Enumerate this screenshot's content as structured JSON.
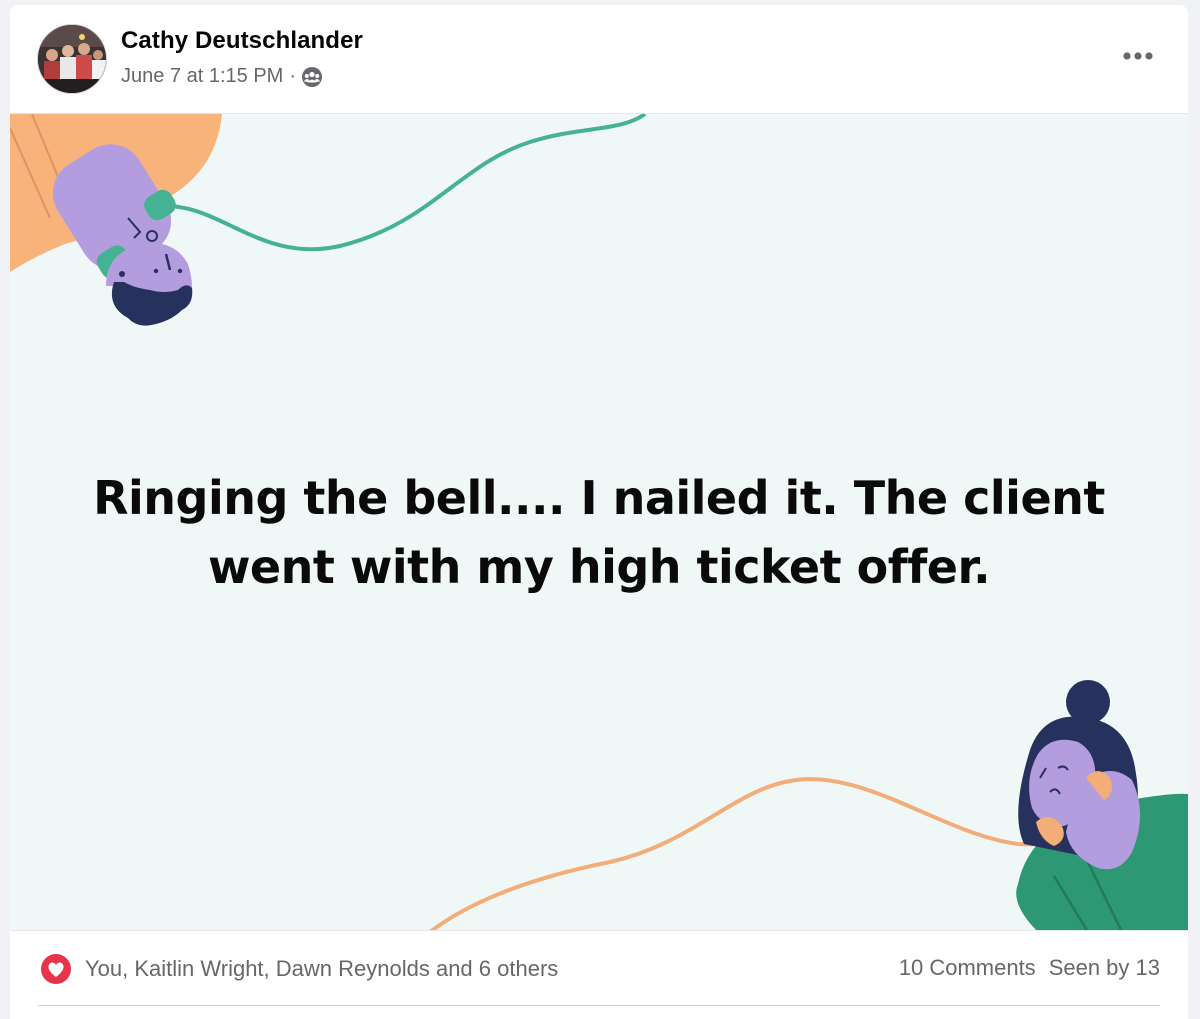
{
  "post": {
    "author": "Cathy Deutschlander",
    "date": "June 7 at 1:15 PM",
    "separator": "·",
    "audience_icon": "group-icon",
    "more_icon": "more-horizontal-icon"
  },
  "image": {
    "text": "Ringing the bell.... I nailed it. The client went with my high ticket offer.",
    "colors": {
      "background": "#f0f8f7",
      "cord_top": "#45b393",
      "cord_bottom": "#f2ad78",
      "phone": "#b39ddf",
      "skin": "#f2ad78",
      "hair": "#26315e",
      "sweater": "#2e9773"
    }
  },
  "footer": {
    "reaction_icon": "love-reaction-icon",
    "reactions_text": "You, Kaitlin Wright, Dawn Reynolds and 6 others",
    "comments": "10 Comments",
    "seen_by": "Seen by 13"
  }
}
